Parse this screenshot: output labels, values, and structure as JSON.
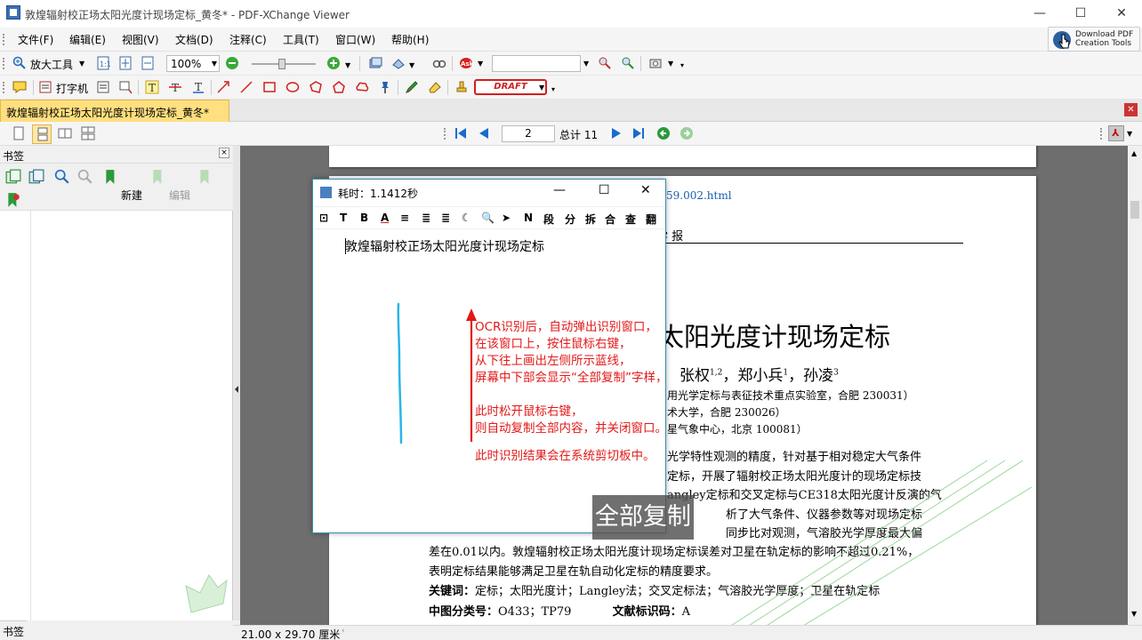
{
  "window": {
    "title": "敦煌辐射校正场太阳光度计现场定标_黄冬* - PDF-XChange Viewer",
    "minimize": "—",
    "maximize": "☐",
    "close": "✕"
  },
  "menu": [
    {
      "label": "文件(F)"
    },
    {
      "label": "编辑(E)"
    },
    {
      "label": "视图(V)"
    },
    {
      "label": "文档(D)"
    },
    {
      "label": "注释(C)"
    },
    {
      "label": "工具(T)"
    },
    {
      "label": "窗口(W)"
    },
    {
      "label": "帮助(H)"
    }
  ],
  "download_button": {
    "line1": "Download PDF",
    "line2": "Creation Tools"
  },
  "toolbar1": {
    "zoom_tool": "放大工具",
    "zoom_value": "100%",
    "search_value": ""
  },
  "toolbar2": {
    "typewriter": "打字机",
    "stamp": "DRAFT"
  },
  "tab": {
    "label": "敦煌辐射校正场太阳光度计现场定标_黄冬*",
    "close": "✕"
  },
  "nav": {
    "page_value": "2",
    "total_label": "总计 11"
  },
  "bookmarks": {
    "title": "书签",
    "close": "×",
    "new_label": "新建",
    "edit_label": "编辑",
    "bottom_tab": "书签"
  },
  "status": {
    "page_size": "21.00 x 29.70 厘米"
  },
  "document": {
    "doi_fragment": "59.002.html",
    "journal_fragment": "学 报",
    "title_fragment": "太阳光度计现场定标",
    "authors_fragment": "张权",
    "author_sup_1": "1,2",
    "author_2": "，郑小兵",
    "author_sup_2": "1",
    "author_3": "，孙凌",
    "author_sup_3": "3",
    "affil_1": "用光学定标与表征技术重点实验室，合肥  230031）",
    "affil_2": "术大学，合肥  230026）",
    "affil_3": "星气象中心，北京  100081）",
    "abstract_lines": [
      "光学特性观测的精度，针对基于相对稳定大气条件",
      "定标，开展了辐射校正场太阳光度计的现场定标技",
      "angley定标和交叉定标与CE318太阳光度计反演的气",
      "析了大气条件、仪器参数等对现场定标",
      "同步比对观测，气溶胶光学厚度最大偏",
      "差在0.01以内。敦煌辐射校正场太阳光度计现场定标误差对卫星在轨定标的影响不超过0.21%，",
      "表明定标结果能够满足卫星在轨自动化定标的精度要求。"
    ],
    "keywords_label": "关键词：",
    "keywords_text": "定标；太阳光度计；Langley法；交叉定标法；气溶胶光学厚度；卫星在轨定标",
    "clc_label": "中图分类号：",
    "clc_value": "O433；TP79",
    "doc_code_label": "文献标识码：",
    "doc_code_value": "A"
  },
  "ocr_window": {
    "title": "耗时：1.1412秒",
    "toolbar": [
      "⊡",
      "T",
      "B",
      "A",
      "≡",
      "≣",
      "≣",
      "☾",
      "🔍",
      "➤",
      "N",
      "段",
      "分",
      "拆",
      "合",
      "查",
      "翻"
    ],
    "recognized_text": "敦煌辐射校正场太阳光度计现场定标"
  },
  "annotation": {
    "lines": [
      "OCR识别后，自动弹出识别窗口，",
      "在该窗口上，按住鼠标右键，",
      "从下往上画出左侧所示蓝线，",
      "屏幕中下部会显示“全部复制”字样，",
      "",
      "此时松开鼠标右键，",
      "则自动复制全部内容，并关闭窗口。",
      "",
      "此时识别结果会在系统剪切板中。"
    ]
  },
  "overlay": {
    "copy_all": "全部复制"
  },
  "colors": {
    "annotation_red": "#e31818",
    "stroke_blue": "#29b6e8",
    "tab_yellow": "#ffdf7f"
  }
}
